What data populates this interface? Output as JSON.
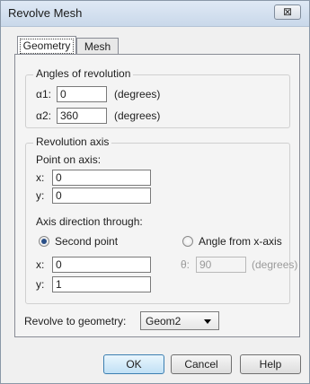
{
  "window": {
    "title": "Revolve Mesh",
    "close_icon": "close-x",
    "close_glyph": "⊠"
  },
  "tabs": [
    {
      "label": "Geometry",
      "selected": true
    },
    {
      "label": "Mesh",
      "selected": false
    }
  ],
  "angles": {
    "title": "Angles of revolution",
    "a1": {
      "label": "α1:",
      "value": "0",
      "units": "(degrees)"
    },
    "a2": {
      "label": "α2:",
      "value": "360",
      "units": "(degrees)"
    }
  },
  "axis": {
    "title": "Revolution axis",
    "point_label": "Point on axis:",
    "point_x": {
      "label": "x:",
      "value": "0"
    },
    "point_y": {
      "label": "y:",
      "value": "0"
    },
    "direction_label": "Axis direction through:",
    "option_second_point": {
      "label": "Second point",
      "selected": true
    },
    "option_angle": {
      "label": "Angle from x-axis",
      "selected": false
    },
    "dir_x": {
      "label": "x:",
      "value": "0"
    },
    "dir_y": {
      "label": "y:",
      "value": "1"
    },
    "theta": {
      "label": "θ:",
      "value": "90",
      "units": "(degrees)",
      "enabled": false
    }
  },
  "revolve_to": {
    "label": "Revolve to geometry:",
    "value": "Geom2"
  },
  "buttons": {
    "ok": "OK",
    "cancel": "Cancel",
    "help": "Help"
  },
  "colors": {
    "radio_dot": "#2a4f87",
    "ok_border": "#3c7fb1"
  }
}
